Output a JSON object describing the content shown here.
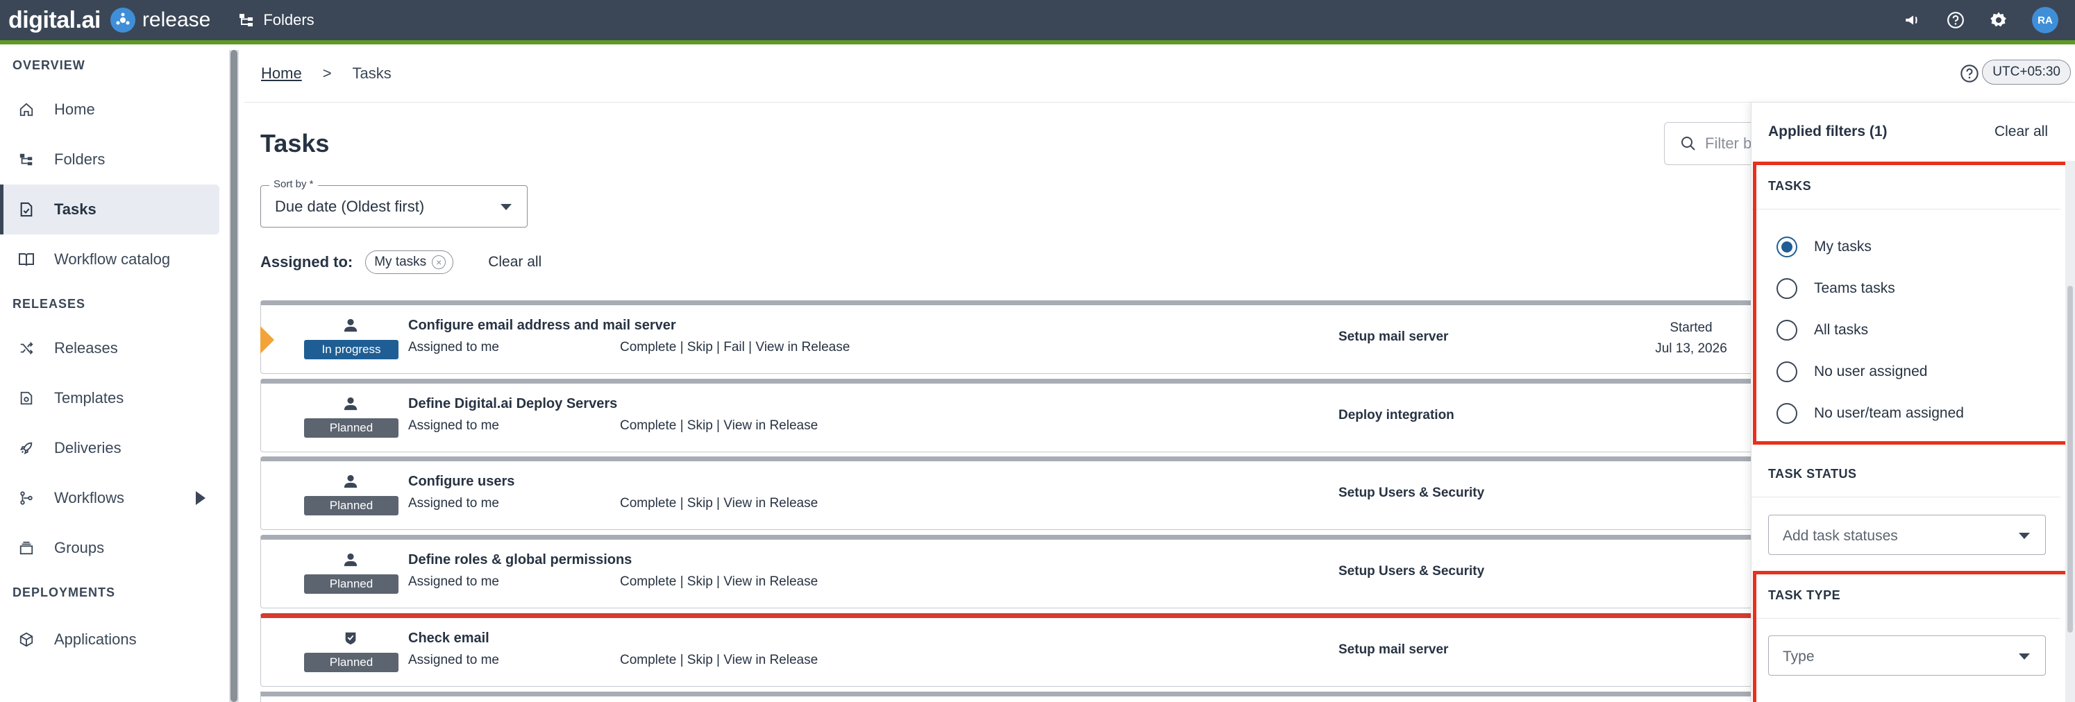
{
  "topbar": {
    "brand_name": "digital.ai",
    "product_name": "release",
    "folders_label": "Folders",
    "user_initials": "RA",
    "accent_color": "#5f9a24",
    "bar_color": "#3b4757",
    "icons": [
      "megaphone-icon",
      "help-icon",
      "gear-icon"
    ]
  },
  "sidebar": {
    "sections": [
      {
        "title": "OVERVIEW",
        "items": [
          {
            "label": "Home",
            "icon": "home-icon"
          },
          {
            "label": "Folders",
            "icon": "folders-icon"
          },
          {
            "label": "Tasks",
            "icon": "tasks-icon",
            "active": true
          },
          {
            "label": "Workflow catalog",
            "icon": "book-icon"
          }
        ]
      },
      {
        "title": "RELEASES",
        "items": [
          {
            "label": "Releases",
            "icon": "shuffle-icon"
          },
          {
            "label": "Templates",
            "icon": "templates-icon"
          },
          {
            "label": "Deliveries",
            "icon": "rocket-icon"
          },
          {
            "label": "Workflows",
            "icon": "workflow-icon",
            "has_submenu": true
          },
          {
            "label": "Groups",
            "icon": "groups-icon"
          }
        ]
      },
      {
        "title": "DEPLOYMENTS",
        "items": [
          {
            "label": "Applications",
            "icon": "cube-icon"
          }
        ]
      }
    ]
  },
  "breadcrumb": {
    "home": "Home",
    "separator": ">",
    "current": "Tasks",
    "timezone": "UTC+05:30"
  },
  "main": {
    "title": "Tasks",
    "filter_placeholder": "Filter b",
    "sort": {
      "label": "Sort by *",
      "value": "Due date (Oldest first)"
    },
    "assigned": {
      "label": "Assigned to:",
      "chip": "My tasks",
      "clear": "Clear all"
    },
    "tasks": [
      {
        "title": "Configure email address and mail server",
        "status": "In progress",
        "assignee": "Assigned to me",
        "actions": "Complete | Skip | Fail | View in Release",
        "phase": "Setup mail server",
        "started_label": "Started",
        "started_date": "Jul 13, 2026"
      },
      {
        "title": "Define Digital.ai Deploy Servers",
        "status": "Planned",
        "assignee": "Assigned to me",
        "actions": "Complete | Skip | View in Release",
        "phase": "Deploy integration"
      },
      {
        "title": "Configure users",
        "status": "Planned",
        "assignee": "Assigned to me",
        "actions": "Complete | Skip | View in Release",
        "phase": "Setup Users & Security"
      },
      {
        "title": "Define roles & global permissions",
        "status": "Planned",
        "assignee": "Assigned to me",
        "actions": "Complete | Skip | View in Release",
        "phase": "Setup Users & Security"
      },
      {
        "title": "Check email",
        "status": "Planned",
        "assignee": "Assigned to me",
        "actions": "Complete | Skip | View in Release",
        "phase": "Setup mail server"
      }
    ]
  },
  "filter_panel": {
    "title": "Applied filters (1)",
    "clear": "Clear all",
    "tasks_section": {
      "title": "TASKS",
      "options": [
        {
          "label": "My tasks",
          "checked": true
        },
        {
          "label": "Teams tasks",
          "checked": false
        },
        {
          "label": "All tasks",
          "checked": false
        },
        {
          "label": "No user assigned",
          "checked": false
        },
        {
          "label": "No user/team assigned",
          "checked": false
        }
      ]
    },
    "status_section": {
      "title": "TASK STATUS",
      "placeholder": "Add task statuses"
    },
    "type_section": {
      "title": "TASK TYPE",
      "placeholder": "Type"
    },
    "highlight_color": "#e8301c"
  }
}
